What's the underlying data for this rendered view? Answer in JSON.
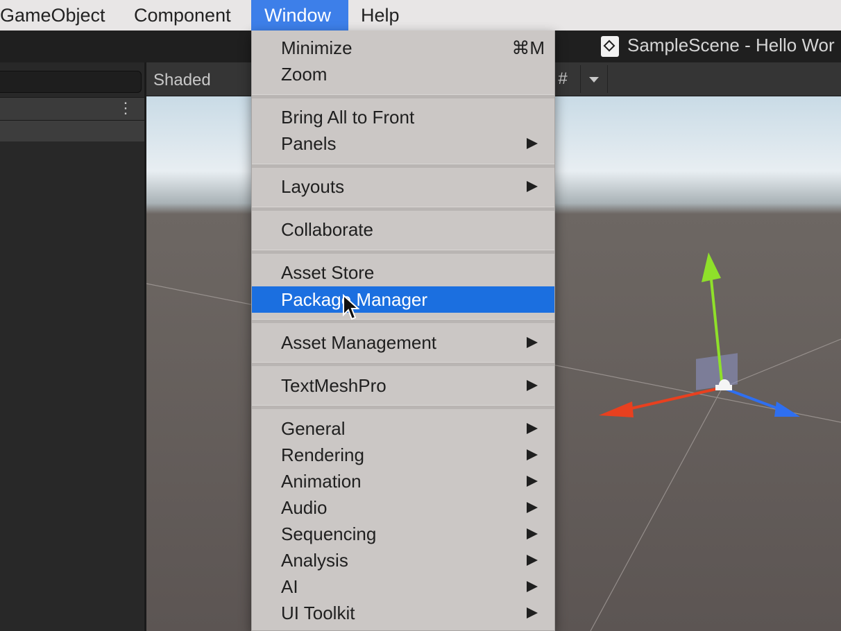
{
  "menubar": {
    "items": [
      {
        "label": "GameObject"
      },
      {
        "label": "Component"
      },
      {
        "label": "Window",
        "active": true
      },
      {
        "label": "Help"
      }
    ]
  },
  "titlebar": {
    "title": "SampleScene - Hello Wor",
    "logo_icon": "unity-logo-icon"
  },
  "scene_view": {
    "shading_mode": "Shaded",
    "gizmos_icon": "gizmos-icon",
    "tab_partial": "# Scene"
  },
  "window_menu": {
    "minimize": {
      "label": "Minimize",
      "shortcut": "⌘M"
    },
    "zoom": {
      "label": "Zoom"
    },
    "bring_all_to_front": {
      "label": "Bring All to Front"
    },
    "panels": {
      "label": "Panels",
      "submenu": true
    },
    "layouts": {
      "label": "Layouts",
      "submenu": true
    },
    "collaborate": {
      "label": "Collaborate"
    },
    "asset_store": {
      "label": "Asset Store"
    },
    "package_manager": {
      "label": "Package Manager",
      "highlighted": true
    },
    "asset_management": {
      "label": "Asset Management",
      "submenu": true
    },
    "textmeshpro": {
      "label": "TextMeshPro",
      "submenu": true
    },
    "general": {
      "label": "General",
      "submenu": true
    },
    "rendering": {
      "label": "Rendering",
      "submenu": true
    },
    "animation": {
      "label": "Animation",
      "submenu": true
    },
    "audio": {
      "label": "Audio",
      "submenu": true
    },
    "sequencing": {
      "label": "Sequencing",
      "submenu": true
    },
    "analysis": {
      "label": "Analysis",
      "submenu": true
    },
    "ai": {
      "label": "AI",
      "submenu": true
    },
    "ui_toolkit": {
      "label": "UI Toolkit",
      "submenu": true
    }
  },
  "colors": {
    "menu_highlight": "#1b6fe0",
    "menubar_active": "#3d7fe9",
    "gizmo_x": "#e8401f",
    "gizmo_y": "#8fe02a",
    "gizmo_z": "#2f6ff0"
  }
}
